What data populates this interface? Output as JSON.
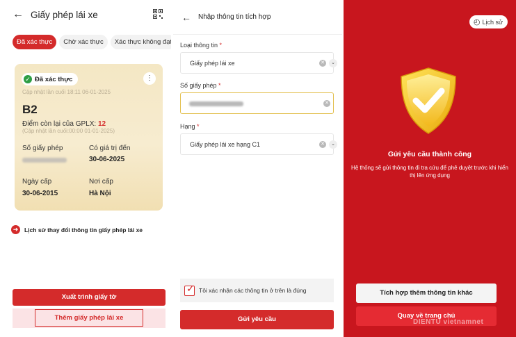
{
  "screen1": {
    "title": "Giấy phép lái xe",
    "tabs": [
      "Đã xác thực",
      "Chờ xác thực",
      "Xác thực không đạt"
    ],
    "card": {
      "status": "Đã xác thực",
      "updated": "Cập nhật lần cuối 18:11 06-01-2025",
      "class": "B2",
      "points_label": "Điểm còn lại của GPLX:",
      "points_value": "12",
      "points_updated": "(Cập nhật lần cuối:00:00 01-01-2025)",
      "license_no_label": "Số giấy phép",
      "valid_until_label": "Có giá trị đến",
      "valid_until": "30-06-2025",
      "issue_date_label": "Ngày cấp",
      "issue_date": "30-06-2015",
      "issue_place_label": "Nơi cấp",
      "issue_place": "Hà Nội"
    },
    "history_link": "Lịch sử thay đổi thông tin giấy phép lái xe",
    "present_button": "Xuất trình giấy tờ",
    "add_button": "Thêm giấy phép lái xe"
  },
  "screen2": {
    "title": "Nhập thông tin tích hợp",
    "info_type_label": "Loại thông tin",
    "info_type_value": "Giấy phép lái xe",
    "license_no_label": "Số giấy phép",
    "class_label": "Hạng",
    "class_value": "Giấy phép lái xe hạng C1",
    "confirm_text": "Tôi xác nhận các thông tin ở trên là đúng",
    "submit_button": "Gửi yêu cầu"
  },
  "screen3": {
    "history_button": "Lịch sử",
    "success_title": "Gửi yêu cầu thành công",
    "success_desc": "Hệ thống sẽ gửi thông tin đi tra cứu để phê duyệt trước khi hiển thị lên ứng dụng",
    "integrate_more_button": "Tích hợp thêm thông tin khác",
    "home_button": "Quay về trang chủ",
    "watermark": "DIENTU vietnamnet"
  },
  "colors": {
    "brand_red": "#d42b2b",
    "success_bg": "#c8161e",
    "shield_yellow": "#f5c518"
  }
}
